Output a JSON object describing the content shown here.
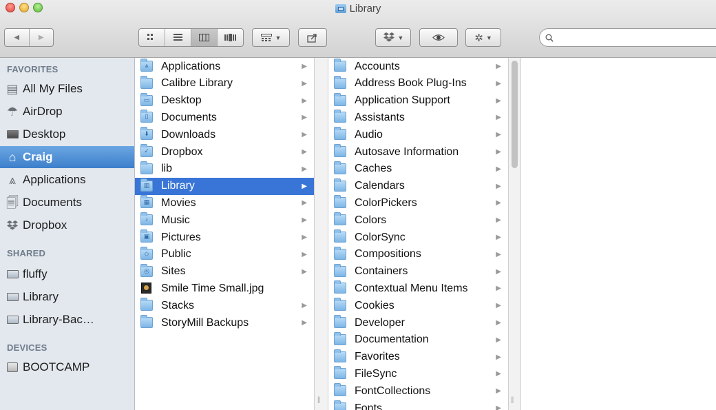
{
  "window": {
    "title": "Library"
  },
  "toolbar": {
    "nav": [
      "◀",
      "▶"
    ],
    "view_modes": [
      "icon-view",
      "list-view",
      "column-view",
      "cover-flow-view"
    ],
    "active_view": "column-view",
    "arrange_icon": "arrange-icon",
    "share_icon": "share-icon",
    "dropbox_icon": "dropbox-icon",
    "quicklook_icon": "eye-icon",
    "action_icon": "gear-icon",
    "search_placeholder": ""
  },
  "sidebar": {
    "sections": [
      {
        "heading": "FAVORITES"
      },
      {
        "heading": "SHARED"
      },
      {
        "heading": "DEVICES"
      }
    ],
    "favorites": [
      {
        "label": "All My Files",
        "icon": "all-files-icon"
      },
      {
        "label": "AirDrop",
        "icon": "airdrop-icon"
      },
      {
        "label": "Desktop",
        "icon": "desktop-icon"
      },
      {
        "label": "Craig",
        "icon": "home-icon"
      },
      {
        "label": "Applications",
        "icon": "applications-icon"
      },
      {
        "label": "Documents",
        "icon": "documents-icon"
      },
      {
        "label": "Dropbox",
        "icon": "dropbox-icon"
      }
    ],
    "selected": "Craig",
    "shared": [
      {
        "label": "fluffy",
        "icon": "server-icon"
      },
      {
        "label": "Library",
        "icon": "monitor-icon"
      },
      {
        "label": "Library-Bac…",
        "icon": "monitor-icon"
      }
    ],
    "devices": [
      {
        "label": "BOOTCAMP",
        "icon": "disk-icon"
      }
    ]
  },
  "column1": {
    "items": [
      {
        "label": "Applications",
        "icon": "applications-folder-icon",
        "arrow": true
      },
      {
        "label": "Calibre Library",
        "icon": "folder-icon",
        "arrow": true
      },
      {
        "label": "Desktop",
        "icon": "desktop-folder-icon",
        "arrow": true
      },
      {
        "label": "Documents",
        "icon": "documents-folder-icon",
        "arrow": true
      },
      {
        "label": "Downloads",
        "icon": "downloads-folder-icon",
        "arrow": true
      },
      {
        "label": "Dropbox",
        "icon": "dropbox-folder-icon",
        "arrow": true
      },
      {
        "label": "lib",
        "icon": "folder-icon",
        "arrow": true
      },
      {
        "label": "Library",
        "icon": "library-folder-icon",
        "arrow": true
      },
      {
        "label": "Movies",
        "icon": "movies-folder-icon",
        "arrow": true
      },
      {
        "label": "Music",
        "icon": "music-folder-icon",
        "arrow": true
      },
      {
        "label": "Pictures",
        "icon": "pictures-folder-icon",
        "arrow": true
      },
      {
        "label": "Public",
        "icon": "public-folder-icon",
        "arrow": true
      },
      {
        "label": "Sites",
        "icon": "sites-folder-icon",
        "arrow": true
      },
      {
        "label": "Smile Time Small.jpg",
        "icon": "image-file-icon",
        "arrow": false
      },
      {
        "label": "Stacks",
        "icon": "folder-icon",
        "arrow": true
      },
      {
        "label": "StoryMill Backups",
        "icon": "folder-icon",
        "arrow": true
      }
    ],
    "selected": "Library"
  },
  "column2": {
    "items": [
      "Accounts",
      "Address Book Plug-Ins",
      "Application Support",
      "Assistants",
      "Audio",
      "Autosave Information",
      "Caches",
      "Calendars",
      "ColorPickers",
      "Colors",
      "ColorSync",
      "Compositions",
      "Containers",
      "Contextual Menu Items",
      "Cookies",
      "Developer",
      "Documentation",
      "Favorites",
      "FileSync",
      "FontCollections",
      "Fonts"
    ]
  }
}
